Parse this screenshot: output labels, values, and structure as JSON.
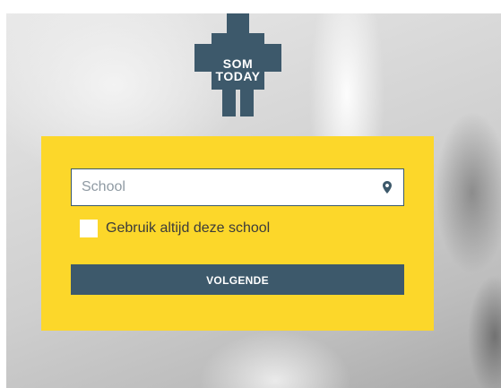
{
  "brand": {
    "logo_line1": "SOM",
    "logo_line2": "TODAY",
    "logo_icon": "som-today-logo",
    "logo_color": "#3d596b"
  },
  "login": {
    "school_placeholder": "School",
    "school_value": "",
    "location_icon": "map-pin-icon",
    "remember_label": "Gebruik altijd deze school",
    "remember_checked": false,
    "next_label": "VOLGENDE"
  },
  "colors": {
    "panel": "#fcd72a",
    "button": "#3d596b",
    "field_border": "#3b5a6c"
  }
}
